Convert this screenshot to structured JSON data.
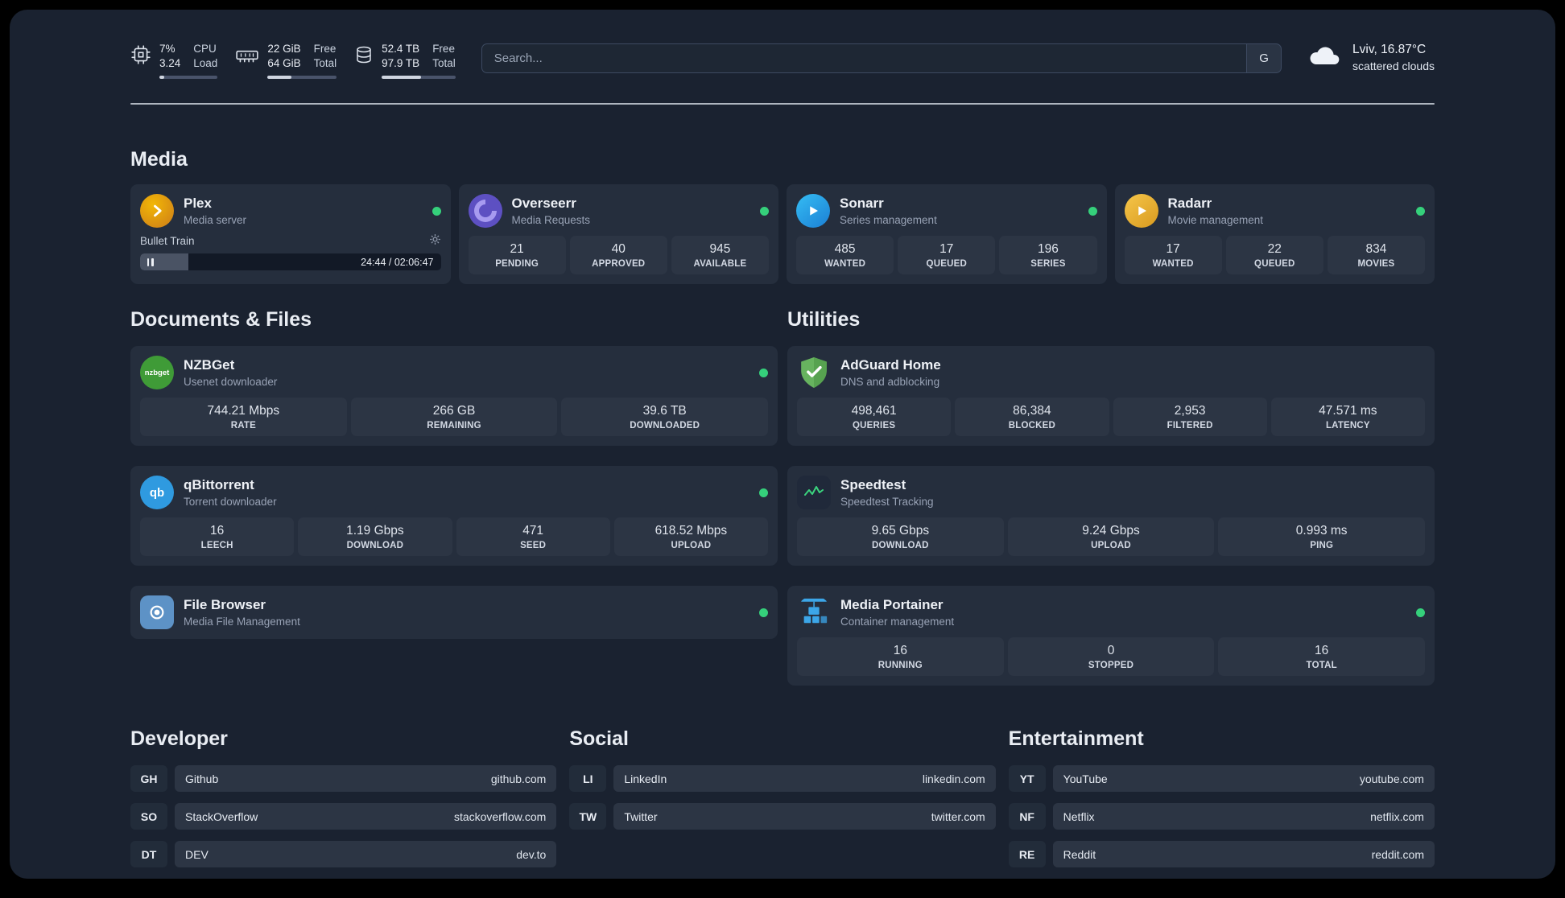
{
  "topbar": {
    "cpu": {
      "percent": "7%",
      "load": "3.24",
      "label_line1": "CPU",
      "label_line2": "Load",
      "progress_pct": 8
    },
    "ram": {
      "free": "22 GiB",
      "total": "64 GiB",
      "free_label": "Free",
      "total_label": "Total",
      "progress_pct": 34
    },
    "disk": {
      "free": "52.4 TB",
      "total": "97.9 TB",
      "free_label": "Free",
      "total_label": "Total",
      "progress_pct": 53
    },
    "search": {
      "placeholder": "Search...",
      "button": "G"
    },
    "weather": {
      "location": "Lviv, 16.87°C",
      "condition": "scattered clouds"
    }
  },
  "media": {
    "title": "Media",
    "plex": {
      "title": "Plex",
      "subtitle": "Media server",
      "now_playing": "Bullet Train",
      "time": "24:44 / 02:06:47",
      "progress_pct": 16
    },
    "overseerr": {
      "title": "Overseerr",
      "subtitle": "Media Requests",
      "stats": [
        {
          "value": "21",
          "label": "PENDING"
        },
        {
          "value": "40",
          "label": "APPROVED"
        },
        {
          "value": "945",
          "label": "AVAILABLE"
        }
      ]
    },
    "sonarr": {
      "title": "Sonarr",
      "subtitle": "Series management",
      "stats": [
        {
          "value": "485",
          "label": "WANTED"
        },
        {
          "value": "17",
          "label": "QUEUED"
        },
        {
          "value": "196",
          "label": "SERIES"
        }
      ]
    },
    "radarr": {
      "title": "Radarr",
      "subtitle": "Movie management",
      "stats": [
        {
          "value": "17",
          "label": "WANTED"
        },
        {
          "value": "22",
          "label": "QUEUED"
        },
        {
          "value": "834",
          "label": "MOVIES"
        }
      ]
    }
  },
  "documents": {
    "title": "Documents & Files",
    "nzbget": {
      "title": "NZBGet",
      "subtitle": "Usenet downloader",
      "stats": [
        {
          "value": "744.21 Mbps",
          "label": "RATE"
        },
        {
          "value": "266 GB",
          "label": "REMAINING"
        },
        {
          "value": "39.6 TB",
          "label": "DOWNLOADED"
        }
      ]
    },
    "qbittorrent": {
      "title": "qBittorrent",
      "subtitle": "Torrent downloader",
      "stats": [
        {
          "value": "16",
          "label": "LEECH"
        },
        {
          "value": "1.19 Gbps",
          "label": "DOWNLOAD"
        },
        {
          "value": "471",
          "label": "SEED"
        },
        {
          "value": "618.52 Mbps",
          "label": "UPLOAD"
        }
      ]
    },
    "filebrowser": {
      "title": "File Browser",
      "subtitle": "Media File Management"
    }
  },
  "utilities": {
    "title": "Utilities",
    "adguard": {
      "title": "AdGuard Home",
      "subtitle": "DNS and adblocking",
      "stats": [
        {
          "value": "498,461",
          "label": "QUERIES"
        },
        {
          "value": "86,384",
          "label": "BLOCKED"
        },
        {
          "value": "2,953",
          "label": "FILTERED"
        },
        {
          "value": "47.571 ms",
          "label": "LATENCY"
        }
      ]
    },
    "speedtest": {
      "title": "Speedtest",
      "subtitle": "Speedtest Tracking",
      "stats": [
        {
          "value": "9.65 Gbps",
          "label": "DOWNLOAD"
        },
        {
          "value": "9.24 Gbps",
          "label": "UPLOAD"
        },
        {
          "value": "0.993 ms",
          "label": "PING"
        }
      ]
    },
    "portainer": {
      "title": "Media Portainer",
      "subtitle": "Container management",
      "stats": [
        {
          "value": "16",
          "label": "RUNNING"
        },
        {
          "value": "0",
          "label": "STOPPED"
        },
        {
          "value": "16",
          "label": "TOTAL"
        }
      ]
    }
  },
  "bookmarks": {
    "developer": {
      "title": "Developer",
      "links": [
        {
          "abbr": "GH",
          "name": "Github",
          "url": "github.com"
        },
        {
          "abbr": "SO",
          "name": "StackOverflow",
          "url": "stackoverflow.com"
        },
        {
          "abbr": "DT",
          "name": "DEV",
          "url": "dev.to"
        }
      ]
    },
    "social": {
      "title": "Social",
      "links": [
        {
          "abbr": "LI",
          "name": "LinkedIn",
          "url": "linkedin.com"
        },
        {
          "abbr": "TW",
          "name": "Twitter",
          "url": "twitter.com"
        }
      ]
    },
    "entertainment": {
      "title": "Entertainment",
      "links": [
        {
          "abbr": "YT",
          "name": "YouTube",
          "url": "youtube.com"
        },
        {
          "abbr": "NF",
          "name": "Netflix",
          "url": "netflix.com"
        },
        {
          "abbr": "RE",
          "name": "Reddit",
          "url": "reddit.com"
        }
      ]
    }
  },
  "colors": {
    "page_bg": "#1a2230",
    "card_bg": "#252e3d",
    "tile_bg": "#2c3544",
    "status_online": "#35d07b",
    "accent_plex": "#e5a00d",
    "accent_adguard": "#67b35f",
    "accent_speedtest_line": "#3bd47e",
    "accent_portainer": "#3ca6e8"
  }
}
